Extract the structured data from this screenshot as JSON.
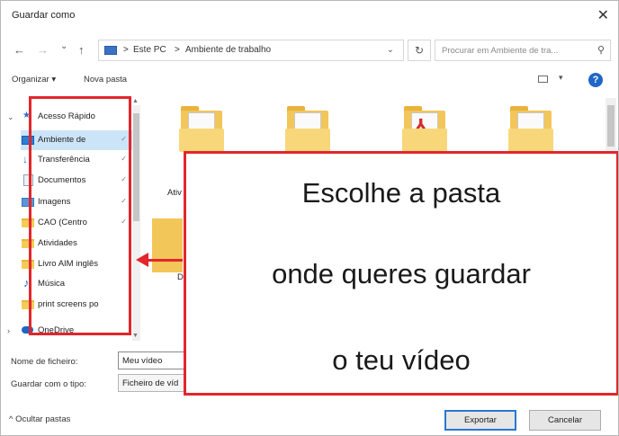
{
  "window": {
    "title": "Guardar como",
    "close_glyph": "✕"
  },
  "nav": {
    "back_glyph": "←",
    "forward_glyph": "→",
    "recent_glyph": "⌄",
    "up_glyph": "↑",
    "address": {
      "separator": ">",
      "segments": [
        "Este PC",
        "Ambiente de trabalho"
      ],
      "dropdown_glyph": "⌄"
    },
    "refresh_glyph": "↻",
    "search_placeholder": "Procurar em Ambiente de tra...",
    "search_glyph": "⚲"
  },
  "toolbar": {
    "organize": "Organizar ▾",
    "new_folder": "Nova pasta",
    "view_caret": "▾",
    "help": "?"
  },
  "sidebar": {
    "quick_access": "Acesso Rápido",
    "items": [
      {
        "label": "Ambiente de",
        "icon": "desktop-icon",
        "pinned": true
      },
      {
        "label": "Transferência",
        "icon": "download-icon",
        "pinned": true
      },
      {
        "label": "Documentos",
        "icon": "documents-icon",
        "pinned": true
      },
      {
        "label": "Imagens",
        "icon": "pictures-icon",
        "pinned": true
      },
      {
        "label": "CAO (Centro",
        "icon": "folder-icon",
        "pinned": true
      },
      {
        "label": "Atividades",
        "icon": "folder-icon",
        "pinned": false
      },
      {
        "label": "Livro AIM inglês",
        "icon": "folder-icon",
        "pinned": false
      },
      {
        "label": "Música",
        "icon": "music-icon",
        "pinned": false
      },
      {
        "label": "print screens po",
        "icon": "folder-icon",
        "pinned": false
      }
    ],
    "onedrive": "OneDrive",
    "pin_glyph": "✓"
  },
  "content": {
    "partial_labels": [
      "Ativ",
      "D"
    ]
  },
  "form": {
    "filename_label": "Nome de ficheiro:",
    "filename_value": "Meu vídeo",
    "filetype_label": "Guardar com o tipo:",
    "filetype_value": "Ficheiro de víd"
  },
  "footer": {
    "hide_folders": "^ Ocultar pastas",
    "export": "Exportar",
    "cancel": "Cancelar"
  },
  "callout": {
    "lines": [
      "Escolhe a pasta",
      "onde queres guardar",
      "o teu vídeo"
    ]
  },
  "colors": {
    "highlight": "#e2262b",
    "selection": "#cce4f7",
    "accent": "#1f66c6",
    "folder": "#f3c65a"
  }
}
